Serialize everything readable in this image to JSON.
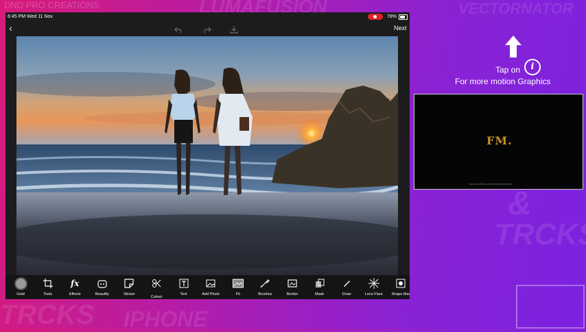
{
  "watermarks": {
    "top_left": "DND PRO CREATIONS",
    "top_center": "LUMAFUSION",
    "top_right": "VECTORNATOR",
    "right_amp": "&",
    "right_tricks": "TRCKS",
    "bottom_left": "TRCKS",
    "bottom_center": "IPHONE"
  },
  "status_bar": {
    "time": "6:45 PM  Wed 11 Nov",
    "battery": "78%"
  },
  "nav": {
    "back_icon": "chevron-left-icon",
    "next_label": "Next"
  },
  "toolbar": {
    "tools": [
      {
        "label": "Gold",
        "icon": "gold-swatch-icon"
      },
      {
        "label": "Tools",
        "icon": "crop-icon"
      },
      {
        "label": "Effects",
        "icon": "fx-icon",
        "glyph": "fx"
      },
      {
        "label": "Beautify",
        "icon": "beautify-icon"
      },
      {
        "label": "Sticker",
        "icon": "sticker-icon"
      },
      {
        "label": "Cutout",
        "icon": "cutout-icon"
      },
      {
        "label": "Text",
        "icon": "text-icon",
        "glyph": "T"
      },
      {
        "label": "Add Photo",
        "icon": "add-photo-icon"
      },
      {
        "label": "Fit",
        "icon": "fit-icon"
      },
      {
        "label": "Brushes",
        "icon": "brushes-icon"
      },
      {
        "label": "Border",
        "icon": "border-icon"
      },
      {
        "label": "Mask",
        "icon": "mask-icon"
      },
      {
        "label": "Draw",
        "icon": "draw-icon"
      },
      {
        "label": "Lens Flare",
        "icon": "lens-flare-icon"
      },
      {
        "label": "Shape Mas",
        "icon": "shape-mask-icon"
      }
    ]
  },
  "overlay": {
    "tap_on": "Tap on",
    "info_glyph": "i",
    "motion": "For more motion Graphics"
  },
  "video_preview": {
    "logo": "FM.",
    "url": "www.youtube.com/dndprocreations"
  },
  "colors": {
    "bg_left": "#d81b7a",
    "bg_right": "#7b22e0",
    "tablet": "#1c1c1e",
    "record": "#e0222a"
  }
}
